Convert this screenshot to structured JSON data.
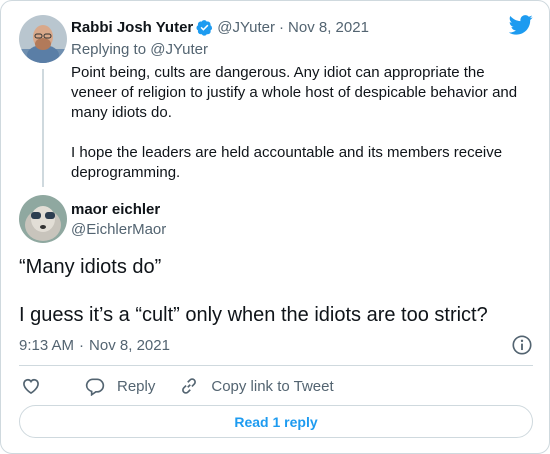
{
  "colors": {
    "brand": "#1d9bf0",
    "text": "#0f1419",
    "muted": "#536471",
    "border": "#cfd9de"
  },
  "parent_tweet": {
    "author_name": "Rabbi Josh Yuter",
    "verified_icon": "verified-badge-icon",
    "handle": "@JYuter",
    "separator": "·",
    "date": "Nov 8, 2021",
    "replying_prefix": "Replying to ",
    "replying_handle": "@JYuter",
    "paragraph1": "Point being, cults are dangerous. Any idiot can appropriate the veneer of religion to justify a whole host of despicable behavior and many idiots do.",
    "paragraph2": "I hope the leaders are held accountable and its members receive deprogramming."
  },
  "main_tweet": {
    "author_name": "maor eichler",
    "handle": "@EichlerMaor",
    "line1": "“Many idiots do”",
    "line2": "I guess it’s a “cult” only when the idiots are too strict?",
    "time": "9:13 AM",
    "separator": "·",
    "date": "Nov 8, 2021"
  },
  "actions": {
    "like_icon": "heart-icon",
    "reply_icon": "reply-icon",
    "reply_label": "Reply",
    "copy_icon": "link-icon",
    "copy_label": "Copy link to Tweet"
  },
  "read_replies_label": "Read 1 reply",
  "logo_icon": "twitter-bird-icon",
  "info_icon": "info-icon"
}
